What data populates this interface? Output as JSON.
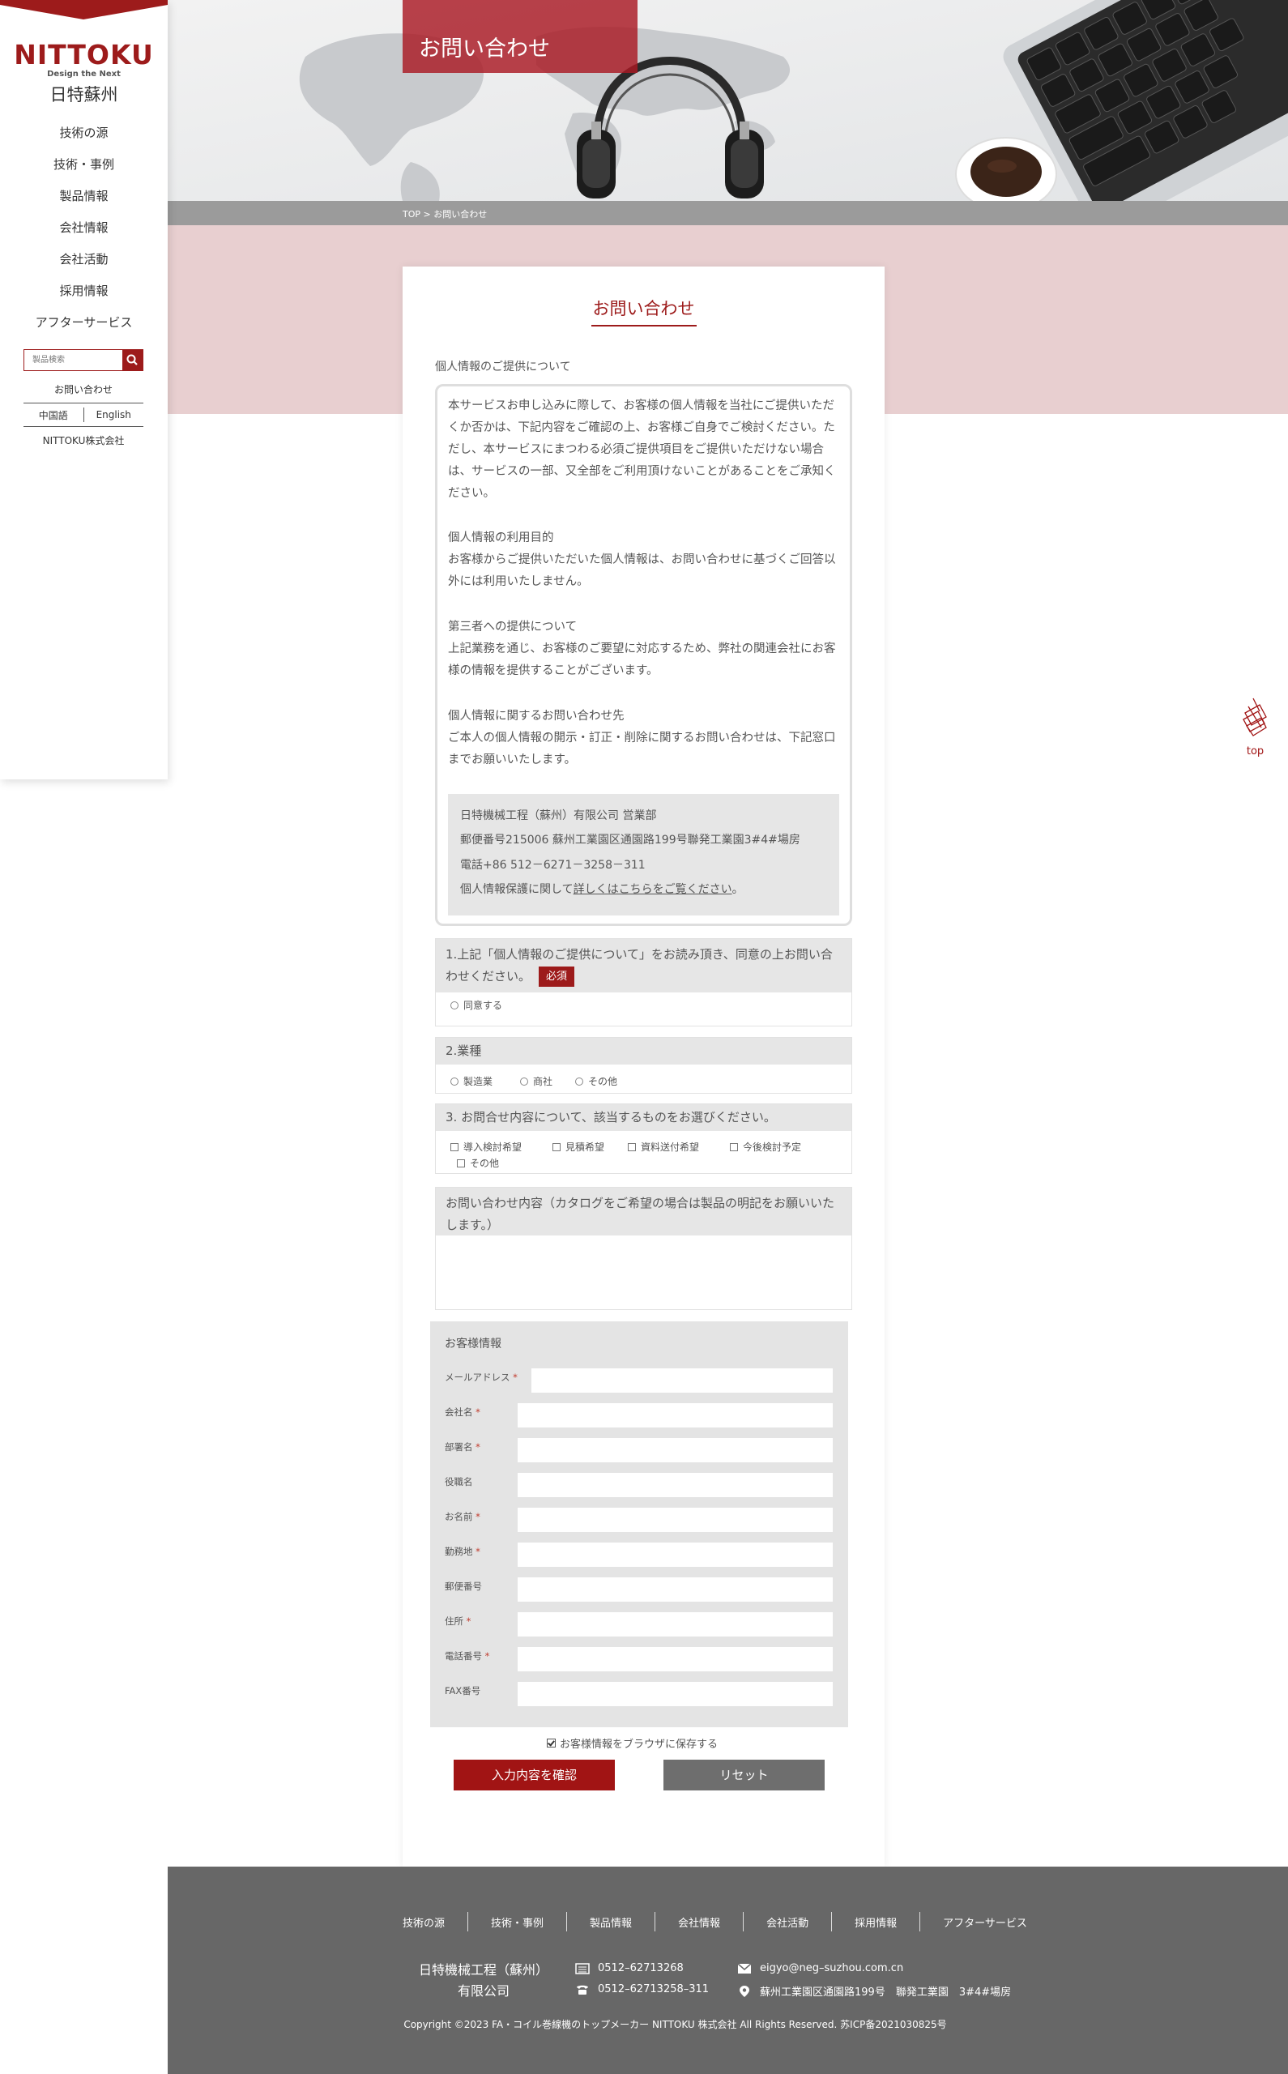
{
  "sidebar": {
    "brand": "NITTOKU",
    "tagline": "Design the Next",
    "company_cn": "日特蘇州",
    "nav": [
      "技術の源",
      "技術・事例",
      "製品情報",
      "会社情報",
      "会社活動",
      "採用情報",
      "アフターサービス"
    ],
    "search_placeholder": "製品検索",
    "contact_link": "お問い合わせ",
    "lang_cn": "中国語",
    "lang_en": "English",
    "parent_company": "NITTOKU株式会社"
  },
  "hero": {
    "title": "お問い合わせ"
  },
  "breadcrumb": "TOP > お問い合わせ",
  "form": {
    "title": "お問い合わせ",
    "privacy_section_label": "個人情報のご提供について",
    "privacy": {
      "intro": "本サービスお申し込みに際して、お客様の個人情報を当社にご提供いただくか否かは、下記内容をご確認の上、お客様ご自身でご検討ください。ただし、本サービスにまつわる必須ご提供項目をご提供いただけない場合は、サービスの一部、又全部をご利用頂けないことがあることをご承知ください。",
      "purpose_title": "個人情報の利用目的",
      "purpose_body": "お客様からご提供いただいた個人情報は、お問い合わせに基づくご回答以外には利用いたしません。",
      "third_title": "第三者への提供について",
      "third_body": "上記業務を通じ、お客様のご要望に対応するため、弊社の関連会社にお客様の情報を提供することがございます。",
      "inquiry_title": "個人情報に関するお問い合わせ先",
      "inquiry_body": "ご本人の個人情報の開示・訂正・削除に関するお問い合わせは、下記窓口までお願いいたします。",
      "addr_company": "日特機械工程（蘇州）有限公司 営業部",
      "addr_postal": "郵便番号215006 蘇州工業園区通園路199号聯発工業園3#4#場房",
      "addr_tel": "電話+86 512－6271－3258－311",
      "addr_link_prefix": "個人情報保護に関して",
      "addr_link": "詳しくはこちらをご覧ください",
      "addr_link_suffix": "。"
    },
    "q1": {
      "label": "1.上記「個人情報のご提供について」をお読み頂き、同意の上お問い合わせください。",
      "required": "必須",
      "option": "同意する"
    },
    "q2": {
      "label": "2.業種",
      "options": [
        "製造業",
        "商社",
        "その他"
      ]
    },
    "q3": {
      "label": "3. お問合せ内容について、該当するものをお選びください。",
      "options": [
        "導入検討希望",
        "見積希望",
        "資料送付希望",
        "今後検討予定",
        "その他"
      ]
    },
    "q4": {
      "label": "お問い合わせ内容（カタログをご希望の場合は製品の明記をお願いいたします。）"
    },
    "customer": {
      "title": "お客様情報",
      "fields": [
        {
          "label": "メールアドレス",
          "required": "*"
        },
        {
          "label": "会社名",
          "required": "*"
        },
        {
          "label": "部署名",
          "required": "*"
        },
        {
          "label": "役職名",
          "required": ""
        },
        {
          "label": "お名前",
          "required": "*"
        },
        {
          "label": "勤務地",
          "required": "*"
        },
        {
          "label": "郵便番号",
          "required": ""
        },
        {
          "label": "住所",
          "required": "*"
        },
        {
          "label": "電話番号",
          "required": "*"
        },
        {
          "label": "FAX番号",
          "required": ""
        }
      ]
    },
    "save_label": "お客様情報をブラウザに保存する",
    "confirm_button": "入力内容を確認",
    "reset_button": "リセット"
  },
  "top_button": "top",
  "footer": {
    "nav": [
      "技術の源",
      "技術・事例",
      "製品情報",
      "会社情報",
      "会社活動",
      "採用情報",
      "アフターサービス"
    ],
    "company_line1": "日特機械工程（蘇州）",
    "company_line2": "有限公司",
    "fax": "0512–62713268",
    "tel": "0512–62713258–311",
    "email": "eigyo@neg–suzhou.com.cn",
    "address": "蘇州工業園区通園路199号　聯発工業園　3#4#場房",
    "copyright": "Copyright ©2023 FA・コイル巻線機のトップメーカー NITTOKU 株式会社 All Rights Reserved. 苏ICP备2021030825号"
  },
  "colors": {
    "brand_red": "#9d1b1b",
    "pink_band": "#e8cfd0",
    "footer_gray": "#676767",
    "reset_gray": "#6e6e6e"
  }
}
